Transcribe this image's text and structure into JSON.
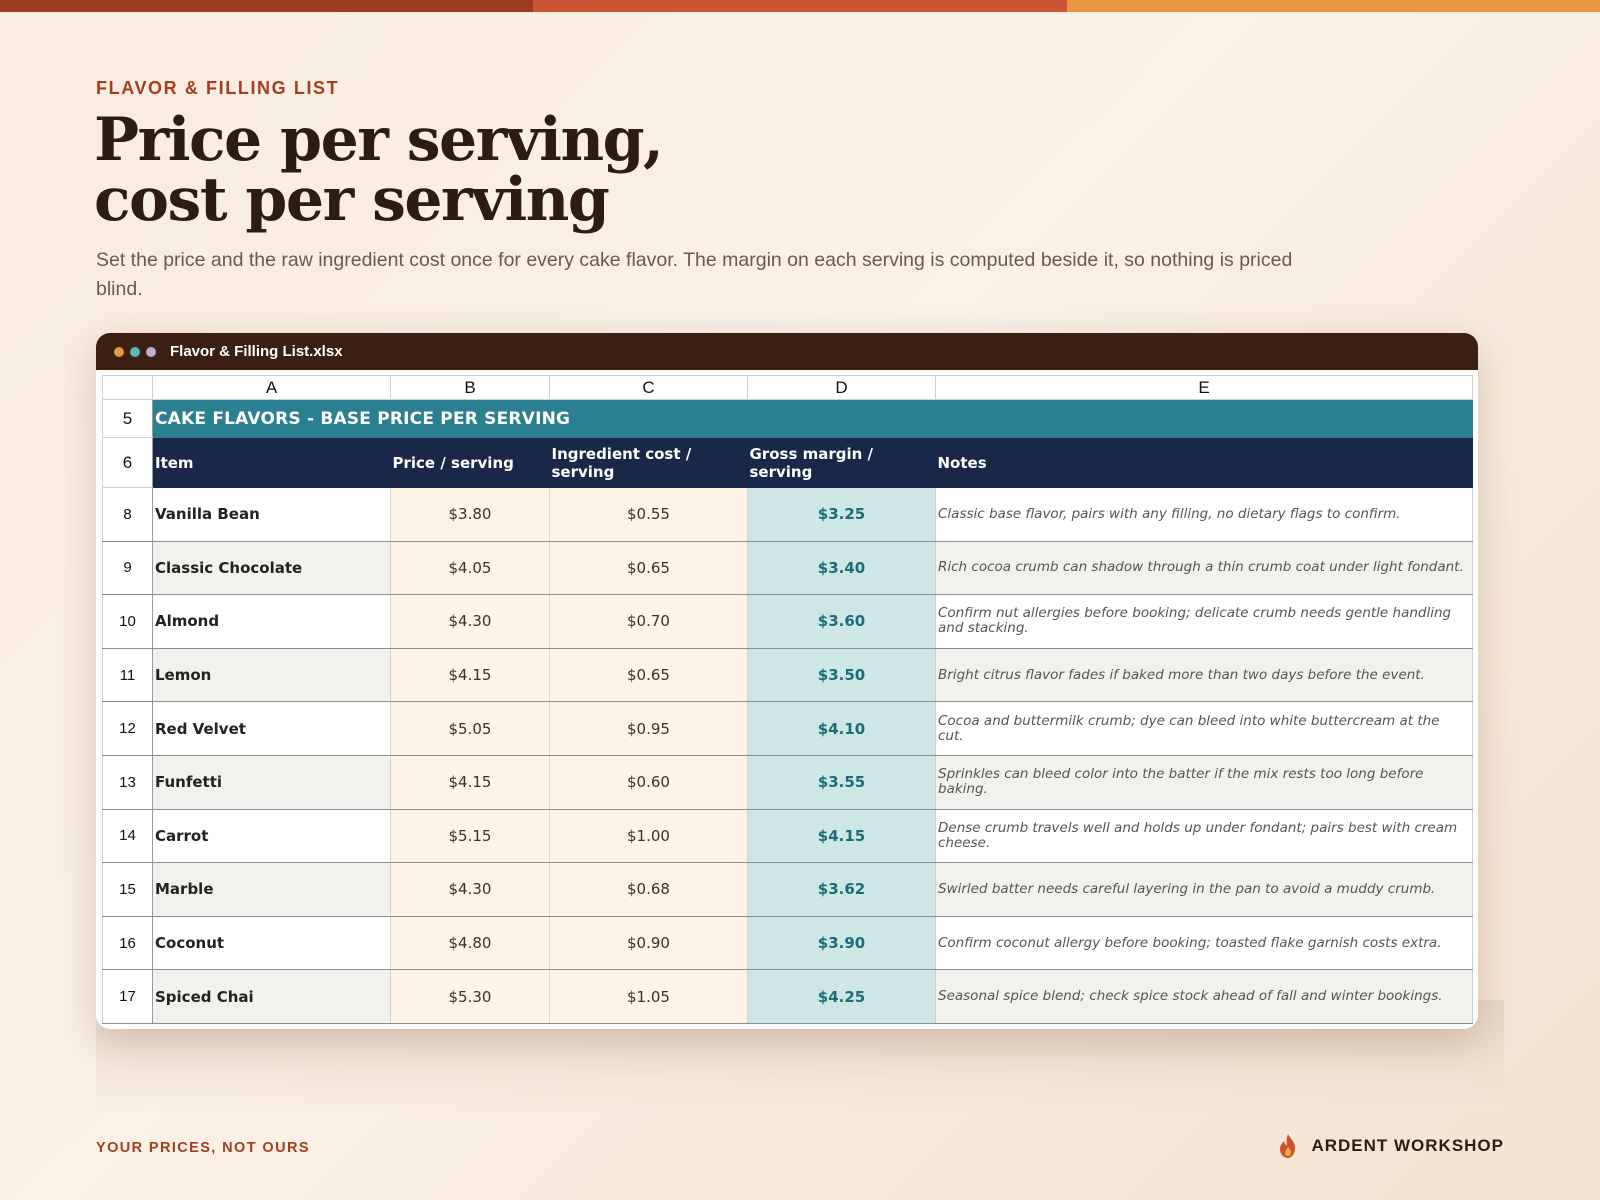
{
  "colors": {
    "accent": "#a33e21",
    "banner": "#2a8090",
    "header": "#192848",
    "margin_text": "#1e6c7a"
  },
  "eyebrow": "FLAVOR & FILLING LIST",
  "title_line1": "Price per serving,",
  "title_line2": "cost per serving",
  "subtitle": "Set the price and the raw ingredient cost once for every cake flavor. The margin on each serving is computed beside it, so nothing is priced blind.",
  "window": {
    "filename": "Flavor & Filling List.xlsx",
    "dots": [
      "orange-dot",
      "teal-dot",
      "lavender-dot"
    ]
  },
  "sheet": {
    "columns": [
      "A",
      "B",
      "C",
      "D",
      "E"
    ],
    "banner": {
      "row": "5",
      "text": "CAKE FLAVORS - BASE PRICE PER SERVING"
    },
    "header": {
      "row": "6",
      "cells": [
        "Item",
        "Price / serving",
        "Ingredient cost / serving",
        "Gross margin / serving",
        "Notes"
      ]
    },
    "rows": [
      {
        "row": "8",
        "item": "Vanilla Bean",
        "price": "$3.80",
        "cost": "$0.55",
        "margin": "$3.25",
        "note": "Classic base flavor, pairs with any filling, no dietary flags to confirm."
      },
      {
        "row": "9",
        "item": "Classic Chocolate",
        "price": "$4.05",
        "cost": "$0.65",
        "margin": "$3.40",
        "note": "Rich cocoa crumb can shadow through a thin crumb coat under light fondant."
      },
      {
        "row": "10",
        "item": "Almond",
        "price": "$4.30",
        "cost": "$0.70",
        "margin": "$3.60",
        "note": "Confirm nut allergies before booking; delicate crumb needs gentle handling and stacking."
      },
      {
        "row": "11",
        "item": "Lemon",
        "price": "$4.15",
        "cost": "$0.65",
        "margin": "$3.50",
        "note": "Bright citrus flavor fades if baked more than two days before the event."
      },
      {
        "row": "12",
        "item": "Red Velvet",
        "price": "$5.05",
        "cost": "$0.95",
        "margin": "$4.10",
        "note": "Cocoa and buttermilk crumb; dye can bleed into white buttercream at the cut."
      },
      {
        "row": "13",
        "item": "Funfetti",
        "price": "$4.15",
        "cost": "$0.60",
        "margin": "$3.55",
        "note": "Sprinkles can bleed color into the batter if the mix rests too long before baking."
      },
      {
        "row": "14",
        "item": "Carrot",
        "price": "$5.15",
        "cost": "$1.00",
        "margin": "$4.15",
        "note": "Dense crumb travels well and holds up under fondant; pairs best with cream cheese."
      },
      {
        "row": "15",
        "item": "Marble",
        "price": "$4.30",
        "cost": "$0.68",
        "margin": "$3.62",
        "note": "Swirled batter needs careful layering in the pan to avoid a muddy crumb."
      },
      {
        "row": "16",
        "item": "Coconut",
        "price": "$4.80",
        "cost": "$0.90",
        "margin": "$3.90",
        "note": "Confirm coconut allergy before booking; toasted flake garnish costs extra."
      },
      {
        "row": "17",
        "item": "Spiced Chai",
        "price": "$5.30",
        "cost": "$1.05",
        "margin": "$4.25",
        "note": "Seasonal spice blend; check spice stock ahead of fall and winter bookings."
      }
    ]
  },
  "footer": {
    "left": "YOUR PRICES, NOT OURS",
    "brand": "ARDENT WORKSHOP",
    "brand_icon": "flame-icon"
  }
}
